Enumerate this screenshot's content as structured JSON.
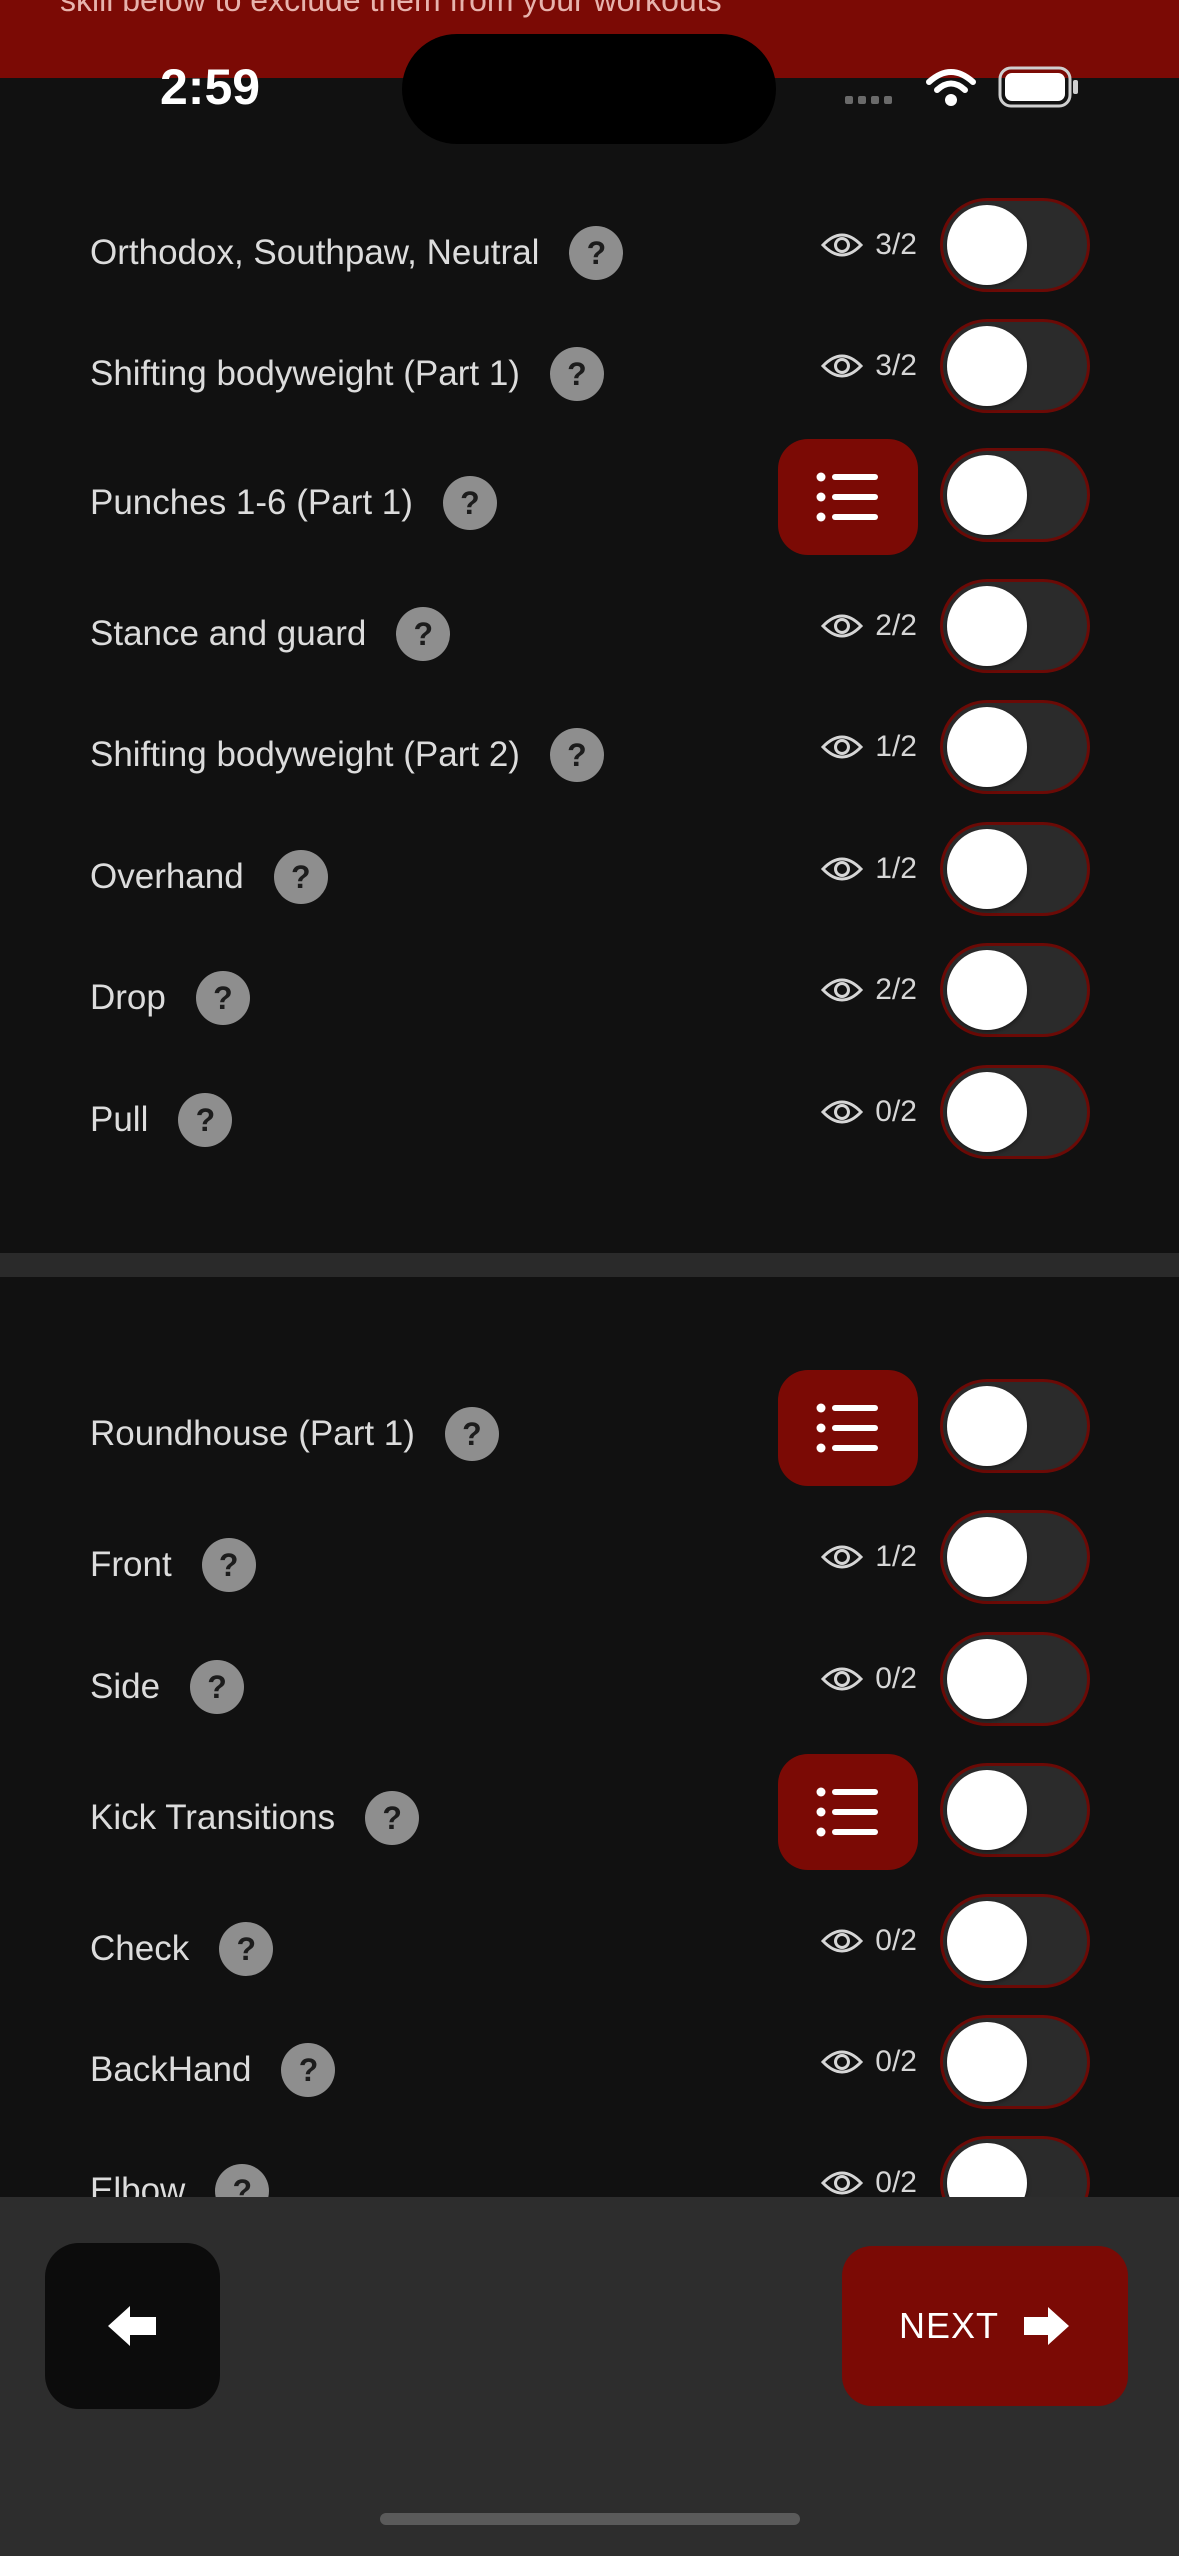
{
  "banner": {
    "text": "skill below to exclude them from your workouts"
  },
  "status": {
    "time": "2:59"
  },
  "section1": {
    "rows": [
      {
        "label": "Orthodox, Southpaw, Neutral",
        "count": "3/2",
        "type": "count"
      },
      {
        "label": "Shifting bodyweight (Part 1)",
        "count": "3/2",
        "type": "count"
      },
      {
        "label": "Punches 1-6 (Part 1)",
        "count": "",
        "type": "list"
      },
      {
        "label": "Stance and guard",
        "count": "2/2",
        "type": "count"
      },
      {
        "label": "Shifting bodyweight (Part 2)",
        "count": "1/2",
        "type": "count"
      },
      {
        "label": "Overhand",
        "count": "1/2",
        "type": "count"
      },
      {
        "label": "Drop",
        "count": "2/2",
        "type": "count"
      },
      {
        "label": "Pull",
        "count": "0/2",
        "type": "count"
      }
    ]
  },
  "section2": {
    "rows": [
      {
        "label": "Roundhouse (Part 1)",
        "count": "",
        "type": "list"
      },
      {
        "label": "Front",
        "count": "1/2",
        "type": "count"
      },
      {
        "label": "Side",
        "count": "0/2",
        "type": "count"
      },
      {
        "label": "Kick Transitions",
        "count": "",
        "type": "list"
      },
      {
        "label": "Check",
        "count": "0/2",
        "type": "count"
      },
      {
        "label": "BackHand",
        "count": "0/2",
        "type": "count"
      },
      {
        "label": "Elbow",
        "count": "0/2",
        "type": "count"
      }
    ]
  },
  "help_symbol": "?",
  "footer": {
    "next_label": "NEXT"
  },
  "icons": {
    "eye": "eye-icon",
    "list": "list-icon",
    "help": "help-icon",
    "back": "arrow-left-icon",
    "next": "arrow-right-icon"
  },
  "colors": {
    "accent": "#7b0a05",
    "background": "#111111",
    "toggle_track": "#2b2b2b"
  },
  "toggles_on": false
}
